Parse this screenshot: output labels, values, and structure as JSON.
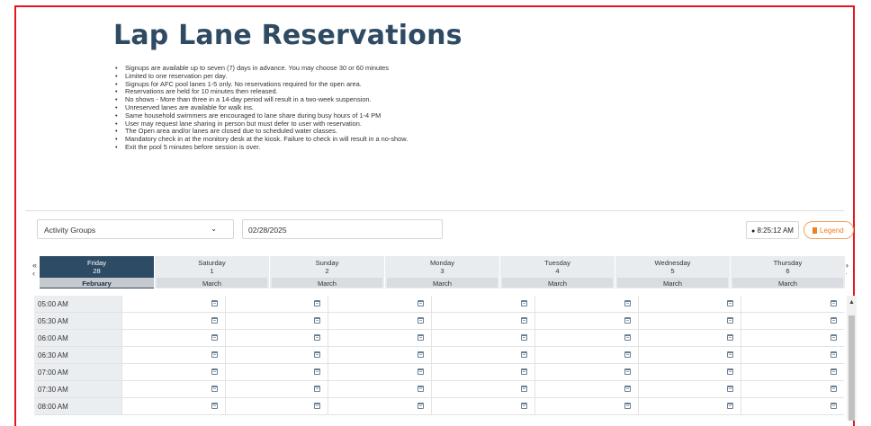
{
  "page": {
    "title": "Lap Lane Reservations",
    "rules": [
      "Signups are available up to seven (7) days in advance. You may choose 30 or 60 minutes",
      "Limited to one reservation per day.",
      "Signups for AFC pool lanes 1-5 only. No reservations required for the open area.",
      "Reservations are held for 10 minutes then released.",
      "No shows - More than three in a 14-day period will result in a two-week suspension.",
      "Unreserved lanes are available for walk ins.",
      "Same household swimmers are encouraged to lane share during busy hours of 1-4 PM",
      "User may request lane sharing in person but must defer to user with reservation.",
      "The Open area and/or lanes are closed due to scheduled water classes.",
      "Mandatory check in at the monitory desk at the kiosk. Failure to check in will result in a no-show.",
      "Exit the pool 5 minutes before session is over."
    ]
  },
  "filters": {
    "activity_group": "Activity Groups",
    "date": "02/28/2025",
    "time": "8:25:12 AM",
    "legend_label": "Legend"
  },
  "nav": {
    "prev": "«\n‹",
    "next": "»\n›"
  },
  "days": [
    {
      "name": "Friday",
      "date": "28",
      "month": "February",
      "active": true
    },
    {
      "name": "Saturday",
      "date": "1",
      "month": "March"
    },
    {
      "name": "Sunday",
      "date": "2",
      "month": "March"
    },
    {
      "name": "Monday",
      "date": "3",
      "month": "March"
    },
    {
      "name": "Tuesday",
      "date": "4",
      "month": "March"
    },
    {
      "name": "Wednesday",
      "date": "5",
      "month": "March"
    },
    {
      "name": "Thursday",
      "date": "6",
      "month": "March"
    }
  ],
  "times": [
    "05:00 AM",
    "05:30 AM",
    "06:00 AM",
    "06:30 AM",
    "07:00 AM",
    "07:30 AM",
    "08:00 AM"
  ],
  "icons": {
    "calendar": "calendar-icon",
    "clock": "clock-icon",
    "bookmark": "bookmark-icon"
  },
  "colors": {
    "accent": "#2e4b65",
    "legend": "#f07f20",
    "frame": "#e3161b"
  }
}
